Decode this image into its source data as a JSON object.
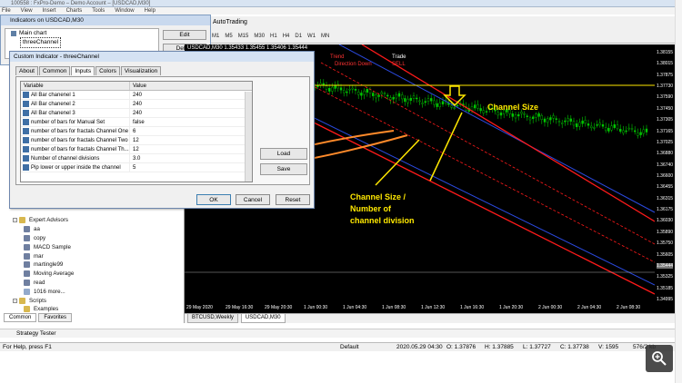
{
  "window": {
    "title": "100558 : FxPro-Demo – Demo Account – [USDCAD,M30]"
  },
  "menu": [
    "File",
    "View",
    "Insert",
    "Charts",
    "Tools",
    "Window",
    "Help"
  ],
  "toolbar": {
    "autotrading": "AutoTrading",
    "timeframes": [
      "M1",
      "M5",
      "M15",
      "M30",
      "H1",
      "H4",
      "D1",
      "W1",
      "MN"
    ]
  },
  "indicators_window": {
    "title": "Indicators on USDCAD,M30",
    "tree": {
      "main": "Main chart",
      "selected": "threeChannel"
    },
    "edit_label": "Edit",
    "delete_label": "Delete"
  },
  "dialog": {
    "title": "Custom Indicator - threeChannel",
    "tabs": [
      "About",
      "Common",
      "Inputs",
      "Colors",
      "Visualization"
    ],
    "active_tab": "Inputs",
    "columns": [
      "Variable",
      "Value"
    ],
    "rows": [
      {
        "variable": "All Bar  chanenel 1",
        "value": "240"
      },
      {
        "variable": "All Bar  chanenel 2",
        "value": "240"
      },
      {
        "variable": "All Bar  chanenel 3",
        "value": "240"
      },
      {
        "variable": "number of bars for Manual Set",
        "value": "false"
      },
      {
        "variable": "number of bars for fractals Channel One",
        "value": "6"
      },
      {
        "variable": "number of bars for fractals Channel Two",
        "value": "12"
      },
      {
        "variable": "number of bars for fractals Channel Th...",
        "value": "12"
      },
      {
        "variable": "Number of channel divisions",
        "value": "3.0"
      },
      {
        "variable": "Pip lower or upper inside the channel",
        "value": "5"
      }
    ],
    "load_label": "Load",
    "save_label": "Save",
    "ok_label": "OK",
    "cancel_label": "Cancel",
    "reset_label": "Reset"
  },
  "navigator": {
    "items": [
      {
        "label": "Expert Advisors",
        "level": 1,
        "icon": "folder-icon"
      },
      {
        "label": "aa",
        "level": 2,
        "icon": "expert-icon"
      },
      {
        "label": "copy",
        "level": 2,
        "icon": "expert-icon"
      },
      {
        "label": "MACD Sample",
        "level": 2,
        "icon": "expert-icon"
      },
      {
        "label": "mar",
        "level": 2,
        "icon": "expert-icon"
      },
      {
        "label": "martingle99",
        "level": 2,
        "icon": "expert-icon"
      },
      {
        "label": "Moving Average",
        "level": 2,
        "icon": "expert-icon"
      },
      {
        "label": "read",
        "level": 2,
        "icon": "expert-icon"
      },
      {
        "label": "1016 more...",
        "level": 2,
        "icon": "globe-icon"
      },
      {
        "label": "Scripts",
        "level": 1,
        "icon": "folder-icon"
      },
      {
        "label": "Examples",
        "level": 2,
        "icon": "folder-icon"
      }
    ],
    "tabs": [
      "Common",
      "Favorites"
    ]
  },
  "chart": {
    "info": "USDCAD,M30  1.35433 1.35455 1.35406 1.35444",
    "trend_label": "Trend",
    "trade_label": "Trade",
    "direction_label": "Direction Down",
    "signal_label": "SELL",
    "annotation_size": "Channel Size",
    "annotation_division": [
      "Channel Size /",
      "Number of",
      "channel division"
    ],
    "prices": [
      "1.38155",
      "1.38015",
      "1.37875",
      "1.37730",
      "1.37590",
      "1.37450",
      "1.37305",
      "1.37165",
      "1.37025",
      "1.36880",
      "1.36740",
      "1.36600",
      "1.36455",
      "1.36315",
      "1.36175",
      "1.36030",
      "1.35890",
      "1.35750",
      "1.35605",
      "1.35444",
      "1.35325",
      "1.35185",
      "1.34995"
    ],
    "current_price": "1.35444",
    "times": [
      "29 May 2020",
      "29 May 16:30",
      "29 May 20:30",
      "1 Jun 00:30",
      "1 Jun 04:30",
      "1 Jun 08:30",
      "1 Jun 12:30",
      "1 Jun 16:30",
      "1 Jun 20:30",
      "2 Jun 00:30",
      "2 Jun 04:30",
      "2 Jun 08:30"
    ],
    "colors": {
      "channel_red": "#ff1a1a",
      "channel_blue": "#2b4ae0",
      "candle_up": "#00c800",
      "candle_down": "#00c800",
      "annotation": "#ffe800",
      "arrow": "#ff8a2a"
    }
  },
  "chart_tabs": [
    "BTCUSD,Weekly",
    "USDCAD,M30"
  ],
  "active_chart_tab": "USDCAD,M30",
  "strategy_tester": "Strategy Tester",
  "status": {
    "help": "For Help, press F1",
    "profile": "Default",
    "datetime": "2020.05.29 04:30",
    "open": "O: 1.37876",
    "high": "H: 1.37885",
    "low": "L: 1.37727",
    "close": "C: 1.37738",
    "volume": "V: 1595",
    "traffic": "576/2 kb"
  }
}
